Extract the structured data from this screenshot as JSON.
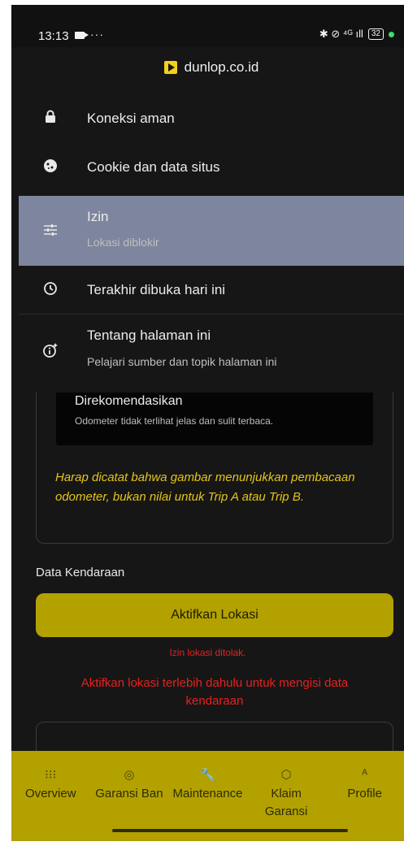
{
  "status_bar": {
    "time": "13:13",
    "dots": "···",
    "right_icons": "✱ ⊘ ⁴ᴳ ıll",
    "battery": "32"
  },
  "popup": {
    "domain": "dunlop.co.id",
    "items": [
      {
        "icon": "lock-icon",
        "title": "Koneksi aman",
        "sub": ""
      },
      {
        "icon": "cookie-icon",
        "title": "Cookie dan data situs",
        "sub": ""
      },
      {
        "icon": "tune-icon",
        "title": "Izin",
        "sub": "Lokasi diblokir"
      },
      {
        "icon": "history-icon",
        "title": "Terakhir dibuka hari ini",
        "sub": ""
      },
      {
        "icon": "info-spark-icon",
        "title": "Tentang halaman ini",
        "sub": "Pelajari sumber dan topik halaman ini"
      }
    ]
  },
  "page": {
    "card_title": "Direkomendasikan",
    "card_sub": "Odometer tidak terlihat jelas dan sulit terbaca.",
    "note": "Harap dicatat bahwa gambar menunjukkan pembacaan odometer, bukan nilai untuk Trip A atau Trip B.",
    "section_label": "Data Kendaraan",
    "location_button": "Aktifkan Lokasi",
    "denied": "Izin lokasi ditolak.",
    "warning": "Aktifkan lokasi terlebih dahulu untuk mengisi data kendaraan"
  },
  "bottom_nav": [
    {
      "icon": "grid-icon",
      "glyph": "⁝⁝⁝",
      "label": "Overview"
    },
    {
      "icon": "check-circle-icon",
      "glyph": "◎",
      "label": "Garansi Ban"
    },
    {
      "icon": "wrench-icon",
      "glyph": "🔧",
      "label": "Maintenance"
    },
    {
      "icon": "shield-icon",
      "glyph": "⬡",
      "label": "Klaim Garansi"
    },
    {
      "icon": "person-icon",
      "glyph": "ᴬ",
      "label": "Profile"
    }
  ],
  "colors": {
    "accent": "#b3a100",
    "selected_row": "#7e859e",
    "error": "#e82020",
    "note": "#e4c51b"
  }
}
